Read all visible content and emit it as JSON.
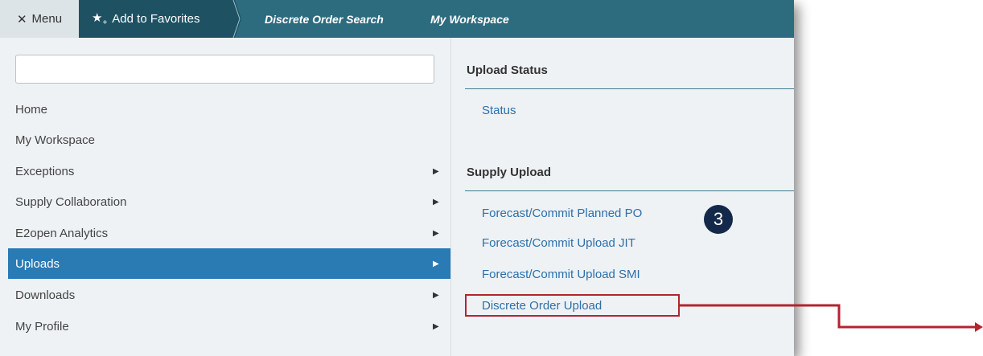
{
  "topbar": {
    "menu_label": "Menu",
    "favorites_label": "Add to Favorites",
    "breadcrumbs": [
      "Discrete Order Search",
      "My Workspace"
    ]
  },
  "search": {
    "placeholder": ""
  },
  "sidebar": {
    "items": [
      {
        "label": "Home",
        "has_submenu": false,
        "active": false
      },
      {
        "label": "My Workspace",
        "has_submenu": false,
        "active": false
      },
      {
        "label": "Exceptions",
        "has_submenu": true,
        "active": false
      },
      {
        "label": "Supply Collaboration",
        "has_submenu": true,
        "active": false
      },
      {
        "label": "E2open Analytics",
        "has_submenu": true,
        "active": false
      },
      {
        "label": "Uploads",
        "has_submenu": true,
        "active": true
      },
      {
        "label": "Downloads",
        "has_submenu": true,
        "active": false
      },
      {
        "label": "My Profile",
        "has_submenu": true,
        "active": false
      }
    ]
  },
  "content": {
    "sections": [
      {
        "title": "Upload Status",
        "links": [
          "Status"
        ]
      },
      {
        "title": "Supply Upload",
        "links": [
          "Forecast/Commit Planned PO",
          "Forecast/Commit Upload JIT",
          "Forecast/Commit Upload SMI",
          "Discrete Order Upload"
        ]
      }
    ]
  },
  "annotation": {
    "step_number": "3",
    "highlight_color": "#b3242e",
    "badge_color": "#14294a"
  },
  "colors": {
    "topbar": "#2d6b7e",
    "active_item": "#2a7ab4",
    "link": "#2e6fa8"
  }
}
